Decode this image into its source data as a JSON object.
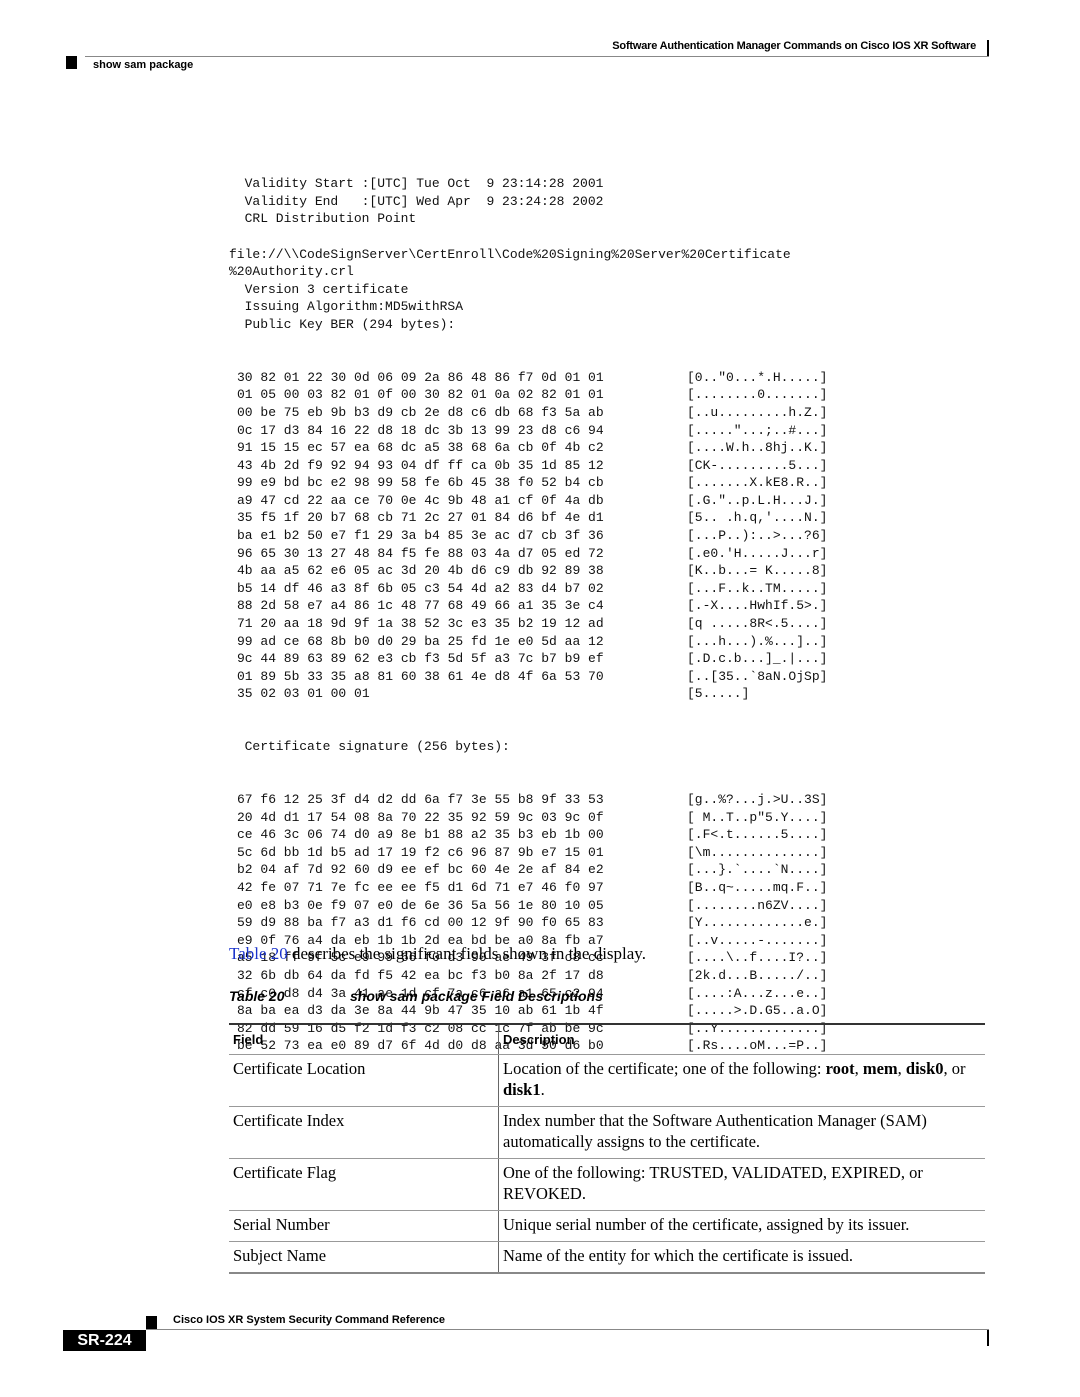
{
  "header": {
    "chapter_title": "Software Authentication Manager Commands on Cisco IOS XR Software",
    "section_title": "show sam package"
  },
  "code": {
    "pre_lines": [
      "  Validity Start :[UTC] Tue Oct  9 23:14:28 2001",
      "  Validity End   :[UTC] Wed Apr  9 23:24:28 2002",
      "  CRL Distribution Point",
      "",
      "file://\\\\CodeSignServer\\CertEnroll\\Code%20Signing%20Server%20Certificate",
      "%20Authority.crl",
      "  Version 3 certificate",
      "  Issuing Algorithm:MD5withRSA",
      "  Public Key BER (294 bytes):"
    ],
    "public_key_rows": [
      {
        "hex": "30 82 01 22 30 0d 06 09 2a 86 48 86 f7 0d 01 01",
        "ascii": "[0..\"0...*.H.....]"
      },
      {
        "hex": "01 05 00 03 82 01 0f 00 30 82 01 0a 02 82 01 01",
        "ascii": "[........0.......]"
      },
      {
        "hex": "00 be 75 eb 9b b3 d9 cb 2e d8 c6 db 68 f3 5a ab",
        "ascii": "[..u.........h.Z.]"
      },
      {
        "hex": "0c 17 d3 84 16 22 d8 18 dc 3b 13 99 23 d8 c6 94",
        "ascii": "[.....\"...;..#...]"
      },
      {
        "hex": "91 15 15 ec 57 ea 68 dc a5 38 68 6a cb 0f 4b c2",
        "ascii": "[....W.h..8hj..K.]"
      },
      {
        "hex": "43 4b 2d f9 92 94 93 04 df ff ca 0b 35 1d 85 12",
        "ascii": "[CK-.........5...]"
      },
      {
        "hex": "99 e9 bd bc e2 98 99 58 fe 6b 45 38 f0 52 b4 cb",
        "ascii": "[.......X.kE8.R..]"
      },
      {
        "hex": "a9 47 cd 22 aa ce 70 0e 4c 9b 48 a1 cf 0f 4a db",
        "ascii": "[.G.\"..p.L.H...J.]"
      },
      {
        "hex": "35 f5 1f 20 b7 68 cb 71 2c 27 01 84 d6 bf 4e d1",
        "ascii": "[5.. .h.q,'....N.]"
      },
      {
        "hex": "ba e1 b2 50 e7 f1 29 3a b4 85 3e ac d7 cb 3f 36",
        "ascii": "[...P..):..>...?6]"
      },
      {
        "hex": "96 65 30 13 27 48 84 f5 fe 88 03 4a d7 05 ed 72",
        "ascii": "[.e0.'H.....J...r]"
      },
      {
        "hex": "4b aa a5 62 e6 05 ac 3d 20 4b d6 c9 db 92 89 38",
        "ascii": "[K..b...= K.....8]"
      },
      {
        "hex": "b5 14 df 46 a3 8f 6b 05 c3 54 4d a2 83 d4 b7 02",
        "ascii": "[...F..k..TM.....]"
      },
      {
        "hex": "88 2d 58 e7 a4 86 1c 48 77 68 49 66 a1 35 3e c4",
        "ascii": "[.-X....HwhIf.5>.]"
      },
      {
        "hex": "71 20 aa 18 9d 9f 1a 38 52 3c e3 35 b2 19 12 ad",
        "ascii": "[q .....8R<.5....]"
      },
      {
        "hex": "99 ad ce 68 8b b0 d0 29 ba 25 fd 1e e0 5d aa 12",
        "ascii": "[...h...).%...]..]"
      },
      {
        "hex": "9c 44 89 63 89 62 e3 cb f3 5d 5f a3 7c b7 b9 ef",
        "ascii": "[.D.c.b...]_.|...]"
      },
      {
        "hex": "01 89 5b 33 35 a8 81 60 38 61 4e d8 4f 6a 53 70",
        "ascii": "[..[35..`8aN.OjSp]"
      },
      {
        "hex": "35 02 03 01 00 01",
        "ascii": "[5.....]"
      }
    ],
    "signature_label": "  Certificate signature (256 bytes):",
    "signature_rows": [
      {
        "hex": "67 f6 12 25 3f d4 d2 dd 6a f7 3e 55 b8 9f 33 53",
        "ascii": "[g..%?...j.>U..3S]"
      },
      {
        "hex": "20 4d d1 17 54 08 8a 70 22 35 92 59 9c 03 9c 0f",
        "ascii": "[ M..T..p\"5.Y....]"
      },
      {
        "hex": "ce 46 3c 06 74 d0 a9 8e b1 88 a2 35 b3 eb 1b 00",
        "ascii": "[.F<.t......5....]"
      },
      {
        "hex": "5c 6d bb 1d b5 ad 17 19 f2 c6 96 87 9b e7 15 01",
        "ascii": "[\\m..............]"
      },
      {
        "hex": "b2 04 af 7d 92 60 d9 ee ef bc 60 4e 2e af 84 e2",
        "ascii": "[...}.`....`N....]"
      },
      {
        "hex": "42 fe 07 71 7e fc ee ee f5 d1 6d 71 e7 46 f0 97",
        "ascii": "[B..q~.....mq.F..]"
      },
      {
        "hex": "e0 e8 b3 0e f9 07 e0 de 6e 36 5a 56 1e 80 10 05",
        "ascii": "[........n6ZV....]"
      },
      {
        "hex": "59 d9 88 ba f7 a3 d1 f6 cd 00 12 9f 90 f0 65 83",
        "ascii": "[Y.............e.]"
      },
      {
        "hex": "e9 0f 76 a4 da eb 1b 1b 2d ea bd be a0 8a fb a7",
        "ascii": "[..v.....-.......]"
      },
      {
        "hex": "a5 18 ff 9f 5c e9 99 66 f0 d3 90 ae 49 3f c8 cc",
        "ascii": "[....\\..f....I?..]"
      },
      {
        "hex": "32 6b db 64 da fd f5 42 ea bc f3 b0 8a 2f 17 d8",
        "ascii": "[2k.d...B...../..]"
      },
      {
        "hex": "cf c0 d8 d4 3a 41 ae 1d cf 7a c6 a6 a1 65 c2 94",
        "ascii": "[....:A...z...e..]"
      },
      {
        "hex": "8a ba ea d3 da 3e 8a 44 9b 47 35 10 ab 61 1b 4f",
        "ascii": "[.....>.D.G5..a.O]"
      },
      {
        "hex": "82 dd 59 16 d5 f2 1d f3 c2 08 cc 1c 7f ab be 9c",
        "ascii": "[..Y.............]"
      },
      {
        "hex": "be 52 73 ea e0 89 d7 6f 4d d0 d8 aa 3d 50 d6 b0",
        "ascii": "[.Rs....oM...=P..]"
      }
    ]
  },
  "paragraph": {
    "link_text": "Table 20",
    "rest": " describes the significant fields shown in the display."
  },
  "table": {
    "caption_number": "Table 20",
    "caption_title": "show sam package Field Descriptions",
    "headers": [
      "Field",
      "Description"
    ],
    "rows": [
      {
        "field": "Certificate Location",
        "desc_parts": [
          {
            "t": "Location of the certificate; one of the following: ",
            "b": false
          },
          {
            "t": "root",
            "b": true
          },
          {
            "t": ", ",
            "b": false
          },
          {
            "t": "mem",
            "b": true
          },
          {
            "t": ", ",
            "b": false
          },
          {
            "t": "disk0",
            "b": true
          },
          {
            "t": ", or ",
            "b": false
          },
          {
            "t": "disk1",
            "b": true
          },
          {
            "t": ".",
            "b": false
          }
        ]
      },
      {
        "field": "Certificate Index",
        "desc_parts": [
          {
            "t": "Index number that the Software Authentication Manager (SAM) automatically assigns to the certificate.",
            "b": false
          }
        ]
      },
      {
        "field": "Certificate Flag",
        "desc_parts": [
          {
            "t": "One of the following: TRUSTED, VALIDATED, EXPIRED, or REVOKED.",
            "b": false
          }
        ]
      },
      {
        "field": "Serial Number",
        "desc_parts": [
          {
            "t": "Unique serial number of the certificate, assigned by its issuer.",
            "b": false
          }
        ]
      },
      {
        "field": "Subject Name",
        "desc_parts": [
          {
            "t": "Name of the entity for which the certificate is issued.",
            "b": false
          }
        ]
      }
    ]
  },
  "footer": {
    "book_title": "Cisco IOS XR System Security Command Reference",
    "page_number": "SR-224"
  }
}
